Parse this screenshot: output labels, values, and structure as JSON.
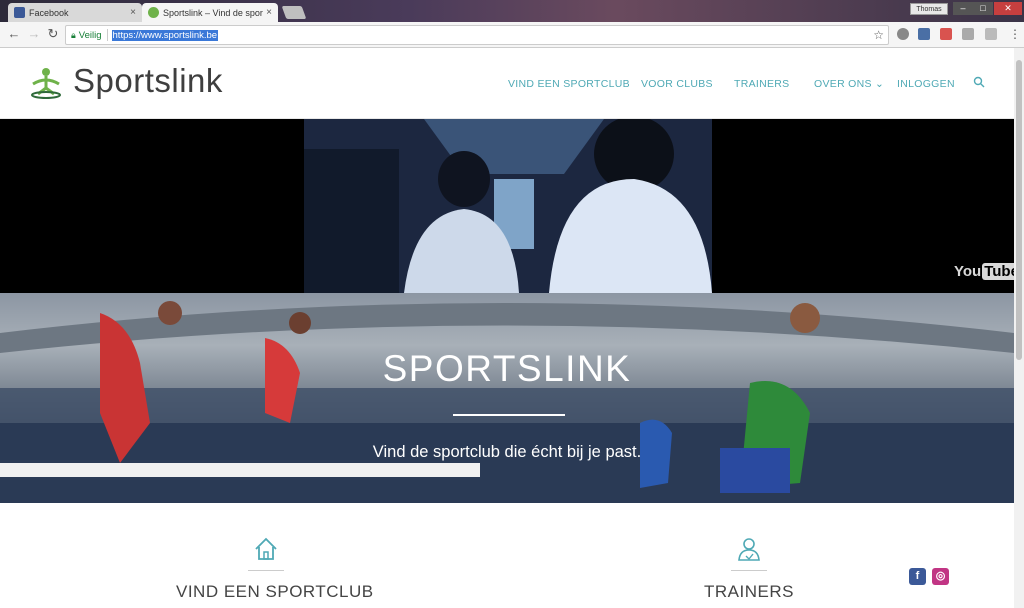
{
  "browser": {
    "tabs": [
      {
        "title": "Facebook",
        "close": "×"
      },
      {
        "title": "Sportslink – Vind de spor",
        "close": "×"
      }
    ],
    "user": "Thomas",
    "window_buttons": {
      "min": "–",
      "max": "□",
      "close": "✕"
    },
    "nav": {
      "back": "←",
      "forward": "→",
      "reload": "↻"
    },
    "address": {
      "secure_label": "Veilig",
      "url": "https://www.sportslink.be"
    },
    "star": "☆",
    "menu": "⋮"
  },
  "site": {
    "logo": "Sportslink",
    "nav": [
      "VIND EEN SPORTCLUB",
      "VOOR CLUBS",
      "TRAINERS",
      "OVER ONS",
      "INLOGGEN"
    ],
    "over_ons_caret": "⌄"
  },
  "video": {
    "youtube_you": "You",
    "youtube_tube": "Tube"
  },
  "hero": {
    "title": "SPORTSLINK",
    "subtitle": "Vind de sportclub die écht bij je past."
  },
  "features": [
    {
      "label": "VIND EEN SPORTCLUB",
      "icon": "home-icon"
    },
    {
      "label": "TRAINERS",
      "icon": "users-icon"
    }
  ],
  "social": [
    {
      "name": "facebook-icon",
      "glyph": "f",
      "color": "#3b5998"
    },
    {
      "name": "instagram-icon",
      "glyph": "◎",
      "color": "#c13584"
    }
  ],
  "colors": {
    "accent": "#4fa9b5",
    "logo_green": "#6fb24a",
    "url_highlight": "#3a78d8"
  }
}
